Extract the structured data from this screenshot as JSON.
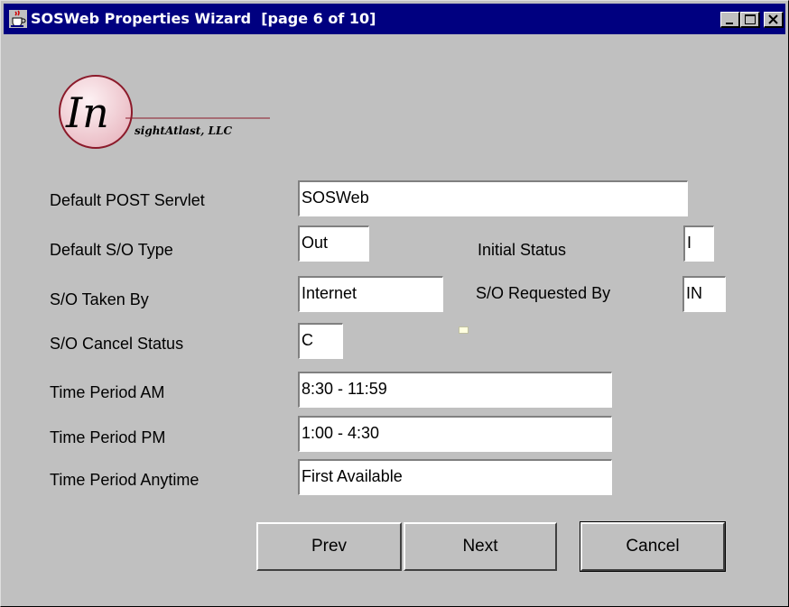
{
  "window": {
    "title": "SOSWeb Properties Wizard  [page 6 of 10]"
  },
  "logo": {
    "initials": "In",
    "tail_text": "sightAtlast, LLC"
  },
  "form": {
    "default_post_servlet": {
      "label": "Default POST Servlet",
      "value": "SOSWeb"
    },
    "default_so_type": {
      "label": "Default S/O Type",
      "value": "Out"
    },
    "initial_status": {
      "label": "Initial Status",
      "value": "I"
    },
    "so_taken_by": {
      "label": "S/O Taken By",
      "value": "Internet"
    },
    "so_requested_by": {
      "label": "S/O Requested By",
      "value": "IN"
    },
    "so_cancel_status": {
      "label": "S/O Cancel Status",
      "value": "C"
    },
    "time_period_am": {
      "label": "Time Period AM",
      "value": "8:30 - 11:59"
    },
    "time_period_pm": {
      "label": "Time Period PM",
      "value": "1:00 - 4:30"
    },
    "time_period_anytime": {
      "label": "Time Period Anytime",
      "value": "First Available"
    }
  },
  "buttons": {
    "prev": "Prev",
    "next": "Next",
    "cancel": "Cancel"
  },
  "colors": {
    "titlebar": "#000080",
    "face": "#c0c0c0",
    "logo_circle": "#f4d7dc",
    "logo_accent": "#8b1a2a"
  },
  "icons": {
    "app": "java-cup-icon",
    "minimize": "minimize-icon",
    "maximize": "maximize-icon",
    "close": "close-icon"
  }
}
